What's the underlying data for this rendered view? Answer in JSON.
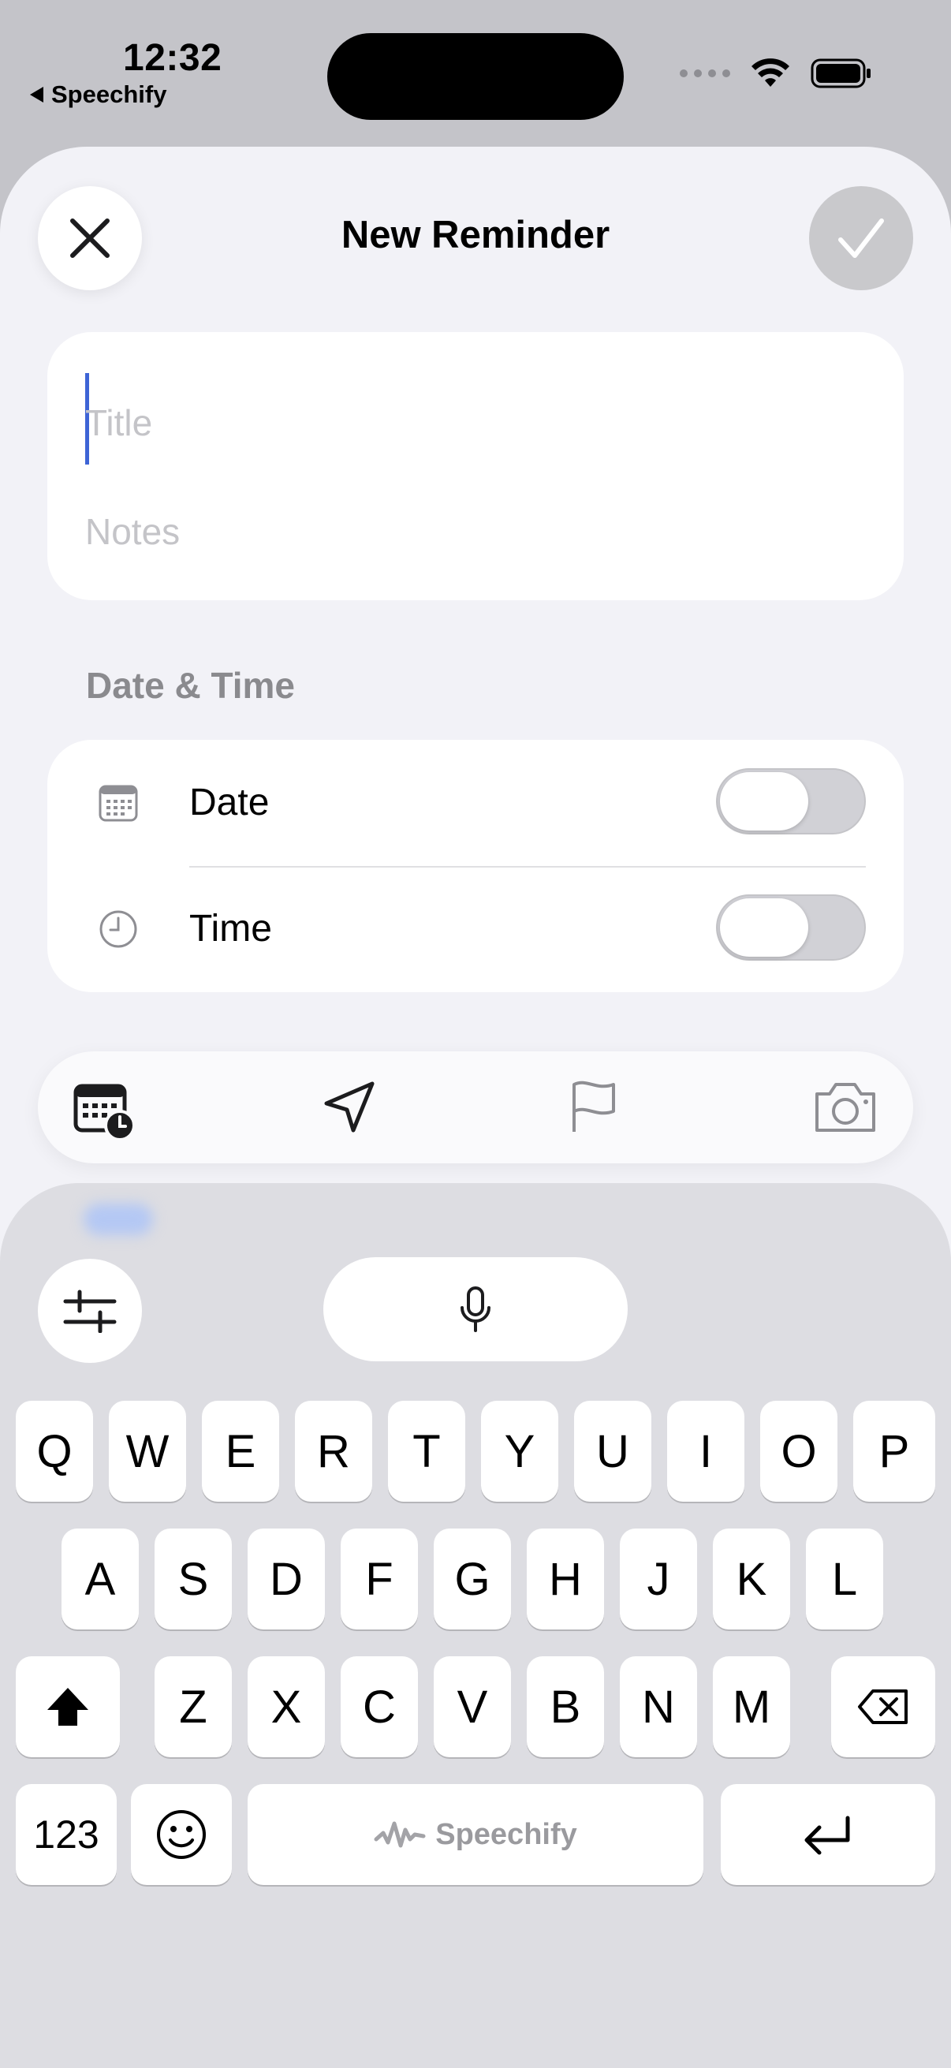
{
  "status_bar": {
    "time": "12:32",
    "back_app": "Speechify"
  },
  "sheet": {
    "title": "New Reminder",
    "close_icon": "close-icon",
    "done_icon": "checkmark-icon"
  },
  "title_card": {
    "title_placeholder": "Title",
    "notes_placeholder": "Notes"
  },
  "date_time": {
    "section_label": "Date & Time",
    "rows": [
      {
        "label": "Date",
        "icon": "calendar-icon",
        "enabled": false
      },
      {
        "label": "Time",
        "icon": "clock-icon",
        "enabled": false
      }
    ]
  },
  "toolbar": {
    "icons": [
      "date-time-icon",
      "location-icon",
      "flag-icon",
      "camera-icon"
    ]
  },
  "keyboard": {
    "row1": [
      "Q",
      "W",
      "E",
      "R",
      "T",
      "Y",
      "U",
      "I",
      "O",
      "P"
    ],
    "row2": [
      "A",
      "S",
      "D",
      "F",
      "G",
      "H",
      "J",
      "K",
      "L"
    ],
    "row3": [
      "Z",
      "X",
      "C",
      "V",
      "B",
      "N",
      "M"
    ],
    "numbers_key": "123",
    "space_label": "Speechify"
  },
  "colors": {
    "caret": "#3e64d6",
    "sheet_background": "#f2f2f7",
    "keyboard_background": "#dddde2"
  }
}
